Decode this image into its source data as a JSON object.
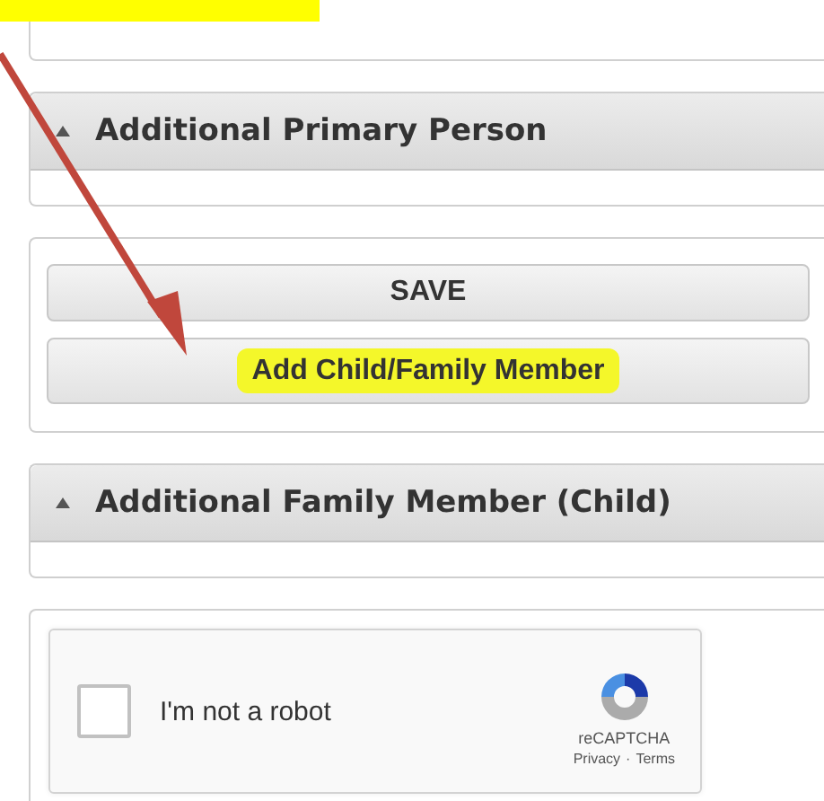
{
  "sections": [
    {
      "kind": "panel_end"
    },
    {
      "kind": "accordion",
      "title": "Additional Primary Person",
      "expanded": true
    },
    {
      "kind": "buttons",
      "buttons": [
        {
          "label": "SAVE",
          "highlighted": false
        },
        {
          "label": "Add Child/Family Member",
          "highlighted": true
        }
      ]
    },
    {
      "kind": "accordion",
      "title": "Additional Family Member (Child)",
      "expanded": true
    },
    {
      "kind": "captcha",
      "label": "I'm not a robot",
      "checked": false,
      "brand": "reCAPTCHA",
      "links": [
        "Privacy",
        "Terms"
      ],
      "separator": "·"
    }
  ]
}
